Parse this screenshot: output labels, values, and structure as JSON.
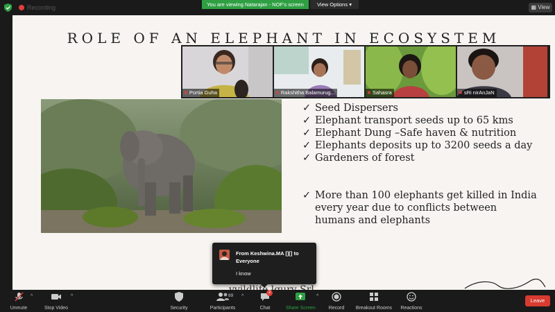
{
  "topbar": {
    "recording_label": "Recording",
    "viewing_banner": "You are viewing Natarajan - NOF's screen",
    "view_options": "View Options",
    "view_button": "View"
  },
  "slide": {
    "title": "ROLE OF AN ELEPHANT IN ECOSYSTEM",
    "check_glyph": "✓",
    "bullets": [
      "Seed Dispersers",
      "Elephant transport seeds up to 65 kms",
      "Elephant Dung –Safe haven & nutrition",
      "Elephants deposits up to 3200 seeds a day",
      "Gardeners of forest"
    ],
    "second_bullet_lines": [
      "More than 100 elephants get killed in India",
      "every year due to conflicts between",
      "humans and elephants"
    ],
    "partial_bottom_text": "vvildlife lgury Srl"
  },
  "participants": [
    {
      "name": "Portia Guha"
    },
    {
      "name": "Rakshitha Balamurug..."
    },
    {
      "name": "Sahasra"
    },
    {
      "name": "sRi nirAnJaN"
    }
  ],
  "chat_toast": {
    "from": "From Keshwina.MA [][] to Everyone",
    "message": "I know"
  },
  "toolbar": {
    "unmute": "Unmute",
    "stop_video": "Stop Video",
    "security": "Security",
    "participants": "Participants",
    "participant_count": "89",
    "chat": "Chat",
    "chat_badge": "2",
    "share_screen": "Share Screen",
    "record": "Record",
    "breakout_rooms": "Breakout Rooms",
    "reactions": "Reactions",
    "leave": "Leave",
    "caret": "^"
  },
  "colors": {
    "share_green": "#2ea043",
    "leave_red": "#d83b30",
    "slide_bg": "#f7f4f1"
  }
}
